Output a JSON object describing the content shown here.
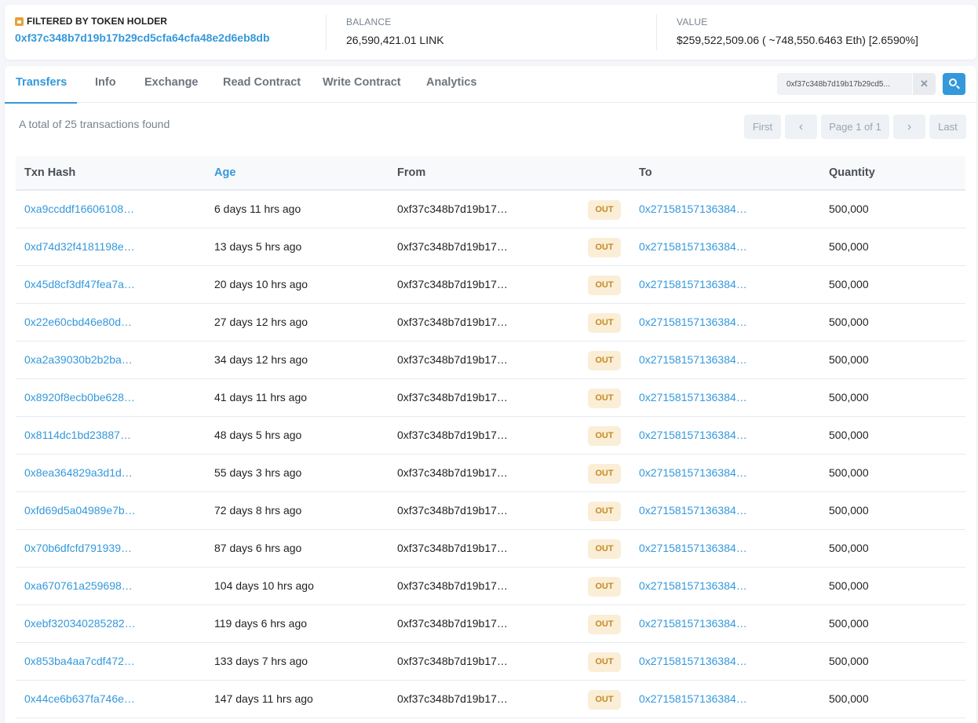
{
  "summary": {
    "filter_label": "FILTERED BY TOKEN HOLDER",
    "holder_address": "0xf37c348b7d19b17b29cd5cfa64cfa48e2d6eb8db",
    "balance_label": "BALANCE",
    "balance_value": "26,590,421.01 LINK",
    "value_label": "VALUE",
    "value_value": "$259,522,509.06 ( ~748,550.6463 Eth) [2.6590%]"
  },
  "tabs": [
    {
      "label": "Transfers",
      "active": true
    },
    {
      "label": "Info"
    },
    {
      "label": "Exchange"
    },
    {
      "label": "Read Contract"
    },
    {
      "label": "Write Contract"
    },
    {
      "label": "Analytics"
    }
  ],
  "search": {
    "value": "0xf37c348b7d19b17b29cd5...",
    "clear_glyph": "✕"
  },
  "total_text": "A total of 25 transactions found",
  "pager": {
    "first": "First",
    "prev": "‹",
    "page": "Page 1 of 1",
    "next": "›",
    "last": "Last"
  },
  "table": {
    "headers": {
      "hash": "Txn Hash",
      "age": "Age",
      "from": "From",
      "to": "To",
      "qty": "Quantity"
    },
    "rows": [
      {
        "hash": "0xa9ccddf16606108…",
        "age": "6 days 11 hrs ago",
        "from": "0xf37c348b7d19b17…",
        "dir": "OUT",
        "to": "0x27158157136384…",
        "qty": "500,000"
      },
      {
        "hash": "0xd74d32f4181198e…",
        "age": "13 days 5 hrs ago",
        "from": "0xf37c348b7d19b17…",
        "dir": "OUT",
        "to": "0x27158157136384…",
        "qty": "500,000"
      },
      {
        "hash": "0x45d8cf3df47fea7a…",
        "age": "20 days 10 hrs ago",
        "from": "0xf37c348b7d19b17…",
        "dir": "OUT",
        "to": "0x27158157136384…",
        "qty": "500,000"
      },
      {
        "hash": "0x22e60cbd46e80d…",
        "age": "27 days 12 hrs ago",
        "from": "0xf37c348b7d19b17…",
        "dir": "OUT",
        "to": "0x27158157136384…",
        "qty": "500,000"
      },
      {
        "hash": "0xa2a39030b2b2ba…",
        "age": "34 days 12 hrs ago",
        "from": "0xf37c348b7d19b17…",
        "dir": "OUT",
        "to": "0x27158157136384…",
        "qty": "500,000"
      },
      {
        "hash": "0x8920f8ecb0be628…",
        "age": "41 days 11 hrs ago",
        "from": "0xf37c348b7d19b17…",
        "dir": "OUT",
        "to": "0x27158157136384…",
        "qty": "500,000"
      },
      {
        "hash": "0x8114dc1bd23887…",
        "age": "48 days 5 hrs ago",
        "from": "0xf37c348b7d19b17…",
        "dir": "OUT",
        "to": "0x27158157136384…",
        "qty": "500,000"
      },
      {
        "hash": "0x8ea364829a3d1d…",
        "age": "55 days 3 hrs ago",
        "from": "0xf37c348b7d19b17…",
        "dir": "OUT",
        "to": "0x27158157136384…",
        "qty": "500,000"
      },
      {
        "hash": "0xfd69d5a04989e7b…",
        "age": "72 days 8 hrs ago",
        "from": "0xf37c348b7d19b17…",
        "dir": "OUT",
        "to": "0x27158157136384…",
        "qty": "500,000"
      },
      {
        "hash": "0x70b6dfcfd791939…",
        "age": "87 days 6 hrs ago",
        "from": "0xf37c348b7d19b17…",
        "dir": "OUT",
        "to": "0x27158157136384…",
        "qty": "500,000"
      },
      {
        "hash": "0xa670761a259698…",
        "age": "104 days 10 hrs ago",
        "from": "0xf37c348b7d19b17…",
        "dir": "OUT",
        "to": "0x27158157136384…",
        "qty": "500,000"
      },
      {
        "hash": "0xebf320340285282…",
        "age": "119 days 6 hrs ago",
        "from": "0xf37c348b7d19b17…",
        "dir": "OUT",
        "to": "0x27158157136384…",
        "qty": "500,000"
      },
      {
        "hash": "0x853ba4aa7cdf472…",
        "age": "133 days 7 hrs ago",
        "from": "0xf37c348b7d19b17…",
        "dir": "OUT",
        "to": "0x27158157136384…",
        "qty": "500,000"
      },
      {
        "hash": "0x44ce6b637fa746e…",
        "age": "147 days 11 hrs ago",
        "from": "0xf37c348b7d19b17…",
        "dir": "OUT",
        "to": "0x27158157136384…",
        "qty": "500,000"
      }
    ]
  },
  "colors": {
    "accent": "#3498db",
    "out_badge_bg": "#fbeed7",
    "out_badge_text": "#c38b23"
  }
}
